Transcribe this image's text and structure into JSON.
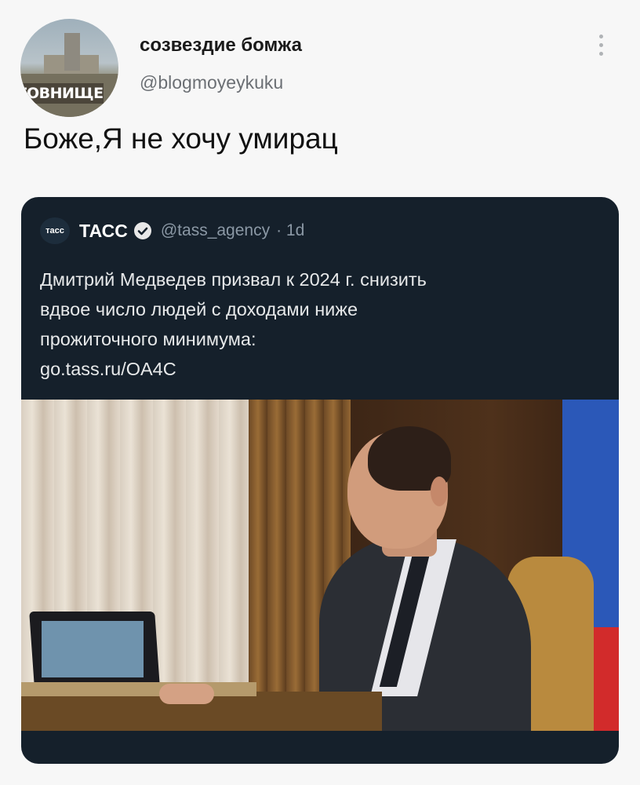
{
  "tweet": {
    "avatar_label": "ГОВНИЩЕ",
    "display_name": "созвездие бомжа",
    "handle": "@blogmoyeykuku",
    "text": "Боже,Я не хочу умирац"
  },
  "quoted": {
    "logo": "тасс",
    "name": "ТАСС",
    "handle": "@tass_agency",
    "time": "· 1d",
    "text_lines": [
      "Дмитрий Медведев призвал к 2024 г. снизить",
      "вдвое число людей с доходами ниже",
      "прожиточного минимума:",
      "go.tass.ru/OA4C"
    ]
  },
  "icons": {
    "more": "more-vertical-icon",
    "verified": "verified-badge-icon"
  },
  "colors": {
    "card_bg": "#15202b",
    "text_dim": "#8b98a5",
    "page_bg": "#f7f7f7"
  }
}
